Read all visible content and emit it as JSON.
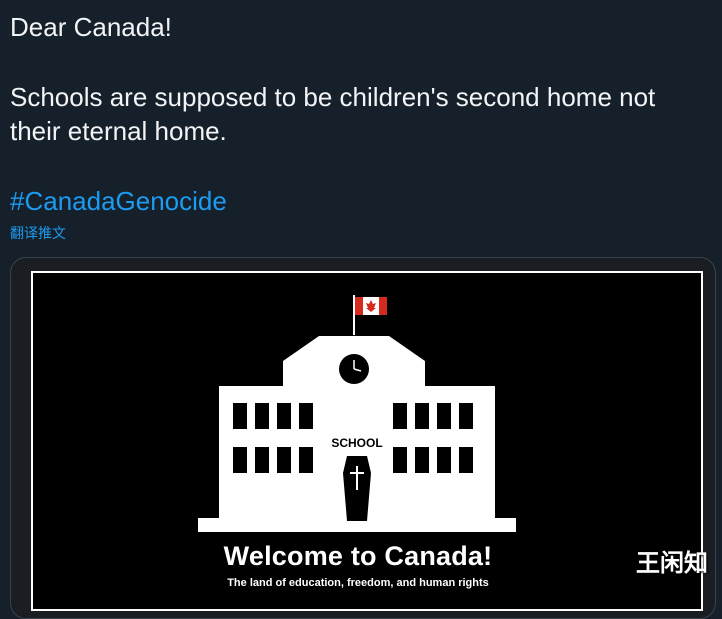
{
  "tweet": {
    "greeting": "Dear Canada!",
    "body": "Schools are supposed to be children's second home not their eternal home.",
    "hashtag": "#CanadaGenocide",
    "translate_label": "翻译推文"
  },
  "poster": {
    "school_sign": "SCHOOL",
    "title": "Welcome to Canada!",
    "subtitle": "The land of education, freedom, and human rights"
  },
  "watermark": "王闲知",
  "colors": {
    "background": "#15202b",
    "link": "#1d9bf0",
    "flag_red": "#d52b1e"
  },
  "icons": [
    "canada-flag-icon",
    "clock-icon",
    "coffin-icon",
    "cross-icon"
  ]
}
